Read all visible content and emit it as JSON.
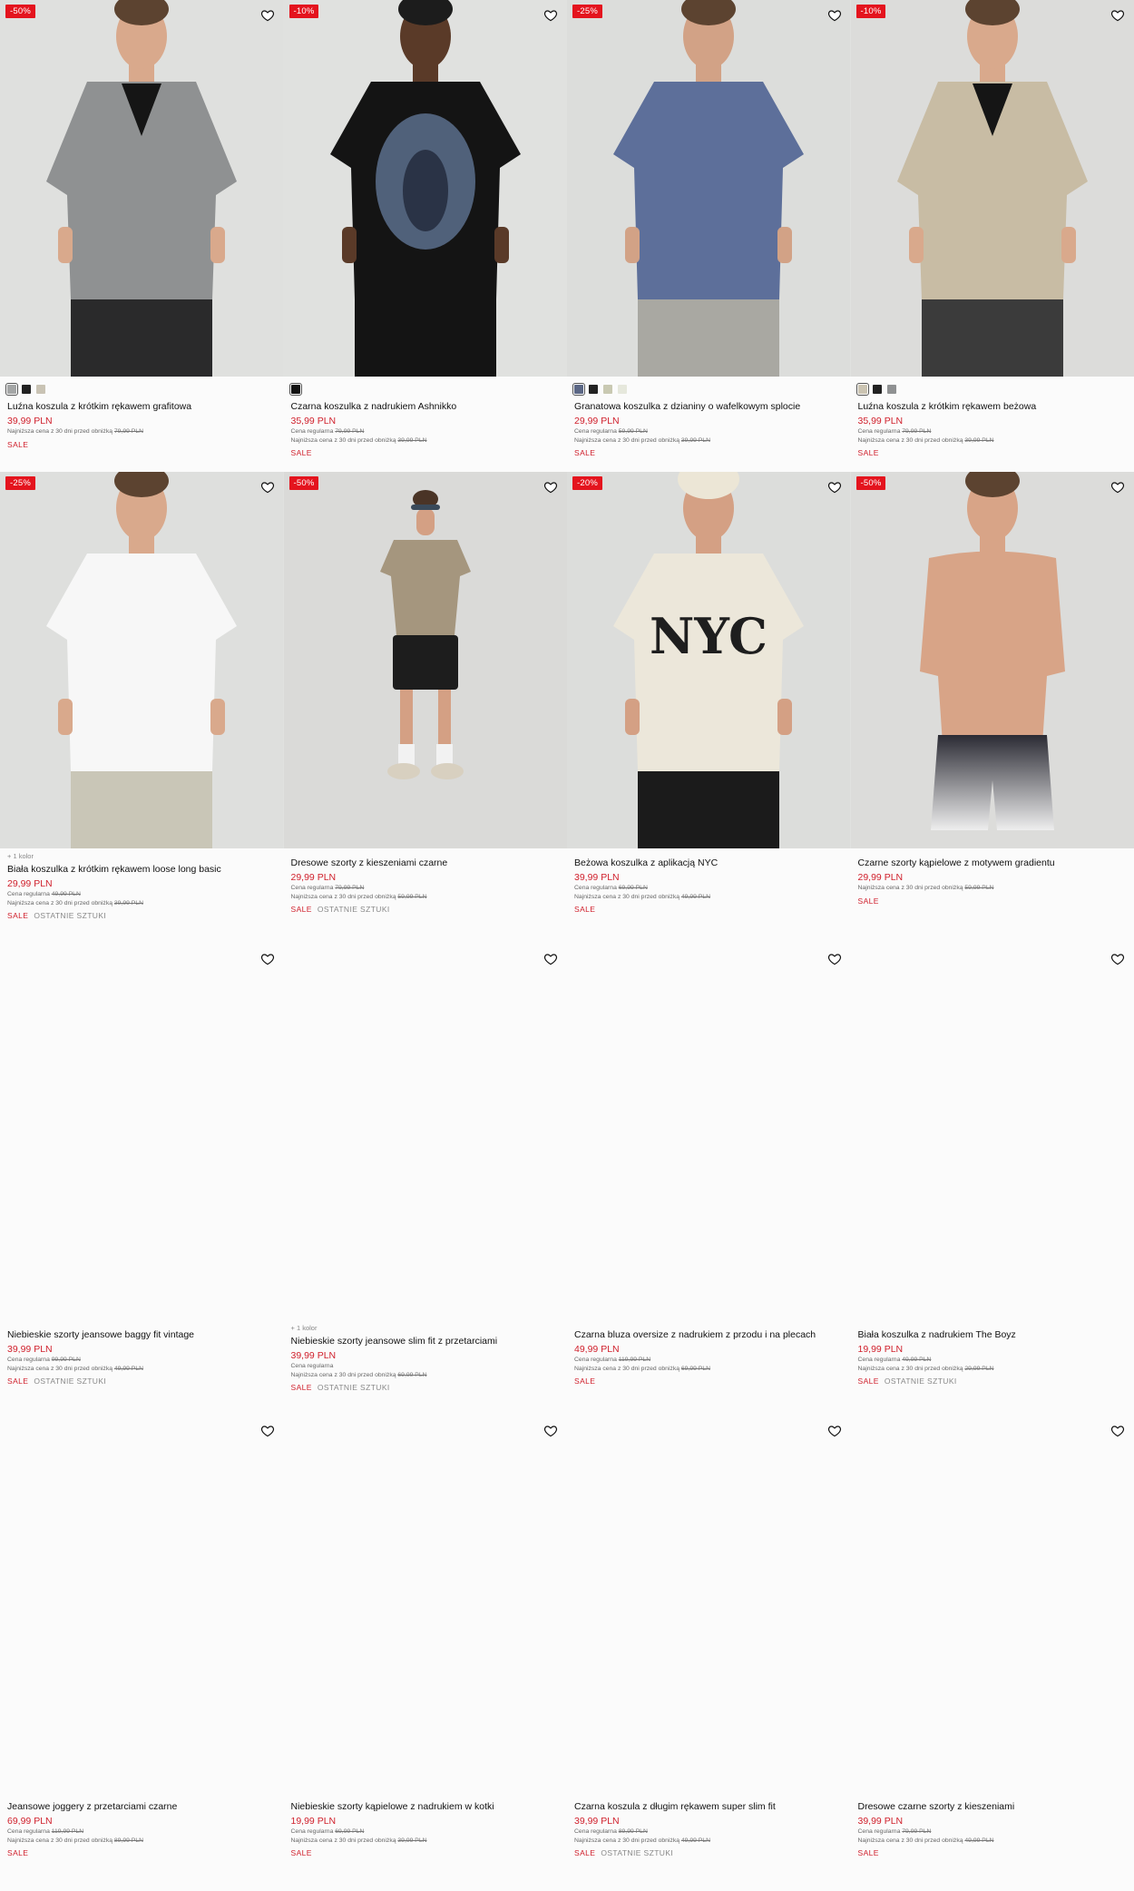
{
  "products": [
    {
      "name": "Luźna koszula z krótkim rękawem grafitowa",
      "price": "39,99 PLN",
      "discount": "-50%",
      "regular_label": "",
      "regular_price": "",
      "lowest_label": "Najniższa cena z 30 dni przed obniżką",
      "lowest_price": "79,99 PLN",
      "tags": [
        "SALE"
      ],
      "swatches": [
        "#a4a6a6",
        "#222222",
        "#c9c3b4"
      ],
      "more_colors": "",
      "image": {
        "bg": "#dfe0de",
        "top": "#8f9192",
        "bottom": "#2a2a2b",
        "skin": "#d9a98c",
        "shape": "shirt"
      }
    },
    {
      "name": "Czarna koszulka z nadrukiem Ashnikko",
      "price": "35,99 PLN",
      "discount": "-10%",
      "regular_label": "Cena regularna",
      "regular_price": "79,99 PLN",
      "lowest_label": "Najniższa cena z 30 dni przed obniżką",
      "lowest_price": "39,99 PLN",
      "tags": [
        "SALE"
      ],
      "swatches": [
        "#111111"
      ],
      "more_colors": "",
      "image": {
        "bg": "#e0e1df",
        "top": "#141414",
        "bottom": "#141414",
        "skin": "#5a3a28",
        "shape": "tee-print"
      }
    },
    {
      "name": "Granatowa koszulka z dzianiny o wafelkowym splocie",
      "price": "29,99 PLN",
      "discount": "-25%",
      "regular_label": "Cena regularna",
      "regular_price": "59,99 PLN",
      "lowest_label": "Najniższa cena z 30 dni przed obniżką",
      "lowest_price": "39,99 PLN",
      "tags": [
        "SALE"
      ],
      "swatches": [
        "#5b6785",
        "#222222",
        "#c9c9b2",
        "#e6e8dc"
      ],
      "more_colors": "",
      "image": {
        "bg": "#dcdddb",
        "top": "#5d6f9a",
        "bottom": "#a9a8a2",
        "skin": "#d2a286",
        "shape": "tee"
      }
    },
    {
      "name": "Luźna koszula z krótkim rękawem beżowa",
      "price": "35,99 PLN",
      "discount": "-10%",
      "regular_label": "Cena regularna",
      "regular_price": "79,99 PLN",
      "lowest_label": "Najniższa cena z 30 dni przed obniżką",
      "lowest_price": "39,99 PLN",
      "tags": [
        "SALE"
      ],
      "swatches": [
        "#cbc4b2",
        "#222222",
        "#8f9192"
      ],
      "more_colors": "",
      "image": {
        "bg": "#dcdcda",
        "top": "#c8bca4",
        "bottom": "#3b3b3b",
        "skin": "#d9a98c",
        "shape": "shirt"
      }
    },
    {
      "name": "Biała koszulka z krótkim rękawem loose long basic",
      "price": "29,99 PLN",
      "discount": "-25%",
      "regular_label": "Cena regularna",
      "regular_price": "49,99 PLN",
      "lowest_label": "Najniższa cena z 30 dni przed obniżką",
      "lowest_price": "39,99 PLN",
      "tags": [
        "SALE",
        "OSTATNIE SZTUKI"
      ],
      "swatches": [],
      "more_colors": "+ 1 kolor",
      "image": {
        "bg": "#dedfdd",
        "top": "#f7f7f7",
        "bottom": "#c9c6b7",
        "skin": "#d9a98c",
        "shape": "tee"
      }
    },
    {
      "name": "Dresowe szorty z kieszeniami czarne",
      "price": "29,99 PLN",
      "discount": "-50%",
      "regular_label": "Cena regularna",
      "regular_price": "79,99 PLN",
      "lowest_label": "Najniższa cena z 30 dni przed obniżką",
      "lowest_price": "59,99 PLN",
      "tags": [
        "SALE",
        "OSTATNIE SZTUKI"
      ],
      "swatches": [],
      "more_colors": "",
      "image": {
        "bg": "#dadad8",
        "top": "#a5967e",
        "bottom": "#1d1d1d",
        "skin": "#d4a084",
        "shape": "full"
      }
    },
    {
      "name": "Beżowa koszulka z aplikacją NYC",
      "price": "39,99 PLN",
      "discount": "-20%",
      "regular_label": "Cena regularna",
      "regular_price": "69,99 PLN",
      "lowest_label": "Najniższa cena z 30 dni przed obniżką",
      "lowest_price": "49,99 PLN",
      "tags": [
        "SALE"
      ],
      "swatches": [],
      "more_colors": "",
      "image": {
        "bg": "#dcdddb",
        "top": "#ece7da",
        "bottom": "#1b1b1b",
        "skin": "#d4a084",
        "shape": "tee-nyc"
      }
    },
    {
      "name": "Czarne szorty kąpielowe z motywem gradientu",
      "price": "29,99 PLN",
      "discount": "-50%",
      "regular_label": "",
      "regular_price": "",
      "lowest_label": "Najniższa cena z 30 dni przed obniżką",
      "lowest_price": "59,99 PLN",
      "tags": [
        "SALE"
      ],
      "swatches": [],
      "more_colors": "",
      "image": {
        "bg": "#dcdcda",
        "top": "#d8a487",
        "bottom": "#2b2b34",
        "skin": "#d8a487",
        "shape": "shirtless"
      }
    },
    {
      "name": "Niebieskie szorty jeansowe baggy fit vintage",
      "price": "39,99 PLN",
      "discount": "",
      "regular_label": "Cena regularna",
      "regular_price": "99,99 PLN",
      "lowest_label": "Najniższa cena z 30 dni przed obniżką",
      "lowest_price": "49,99 PLN",
      "tags": [
        "SALE",
        "OSTATNIE SZTUKI"
      ],
      "swatches": [],
      "more_colors": "",
      "image": null
    },
    {
      "name": "Niebieskie szorty jeansowe slim fit z przetarciami",
      "price": "39,99 PLN",
      "discount": "",
      "regular_label": "Cena regularna",
      "regular_price": "",
      "lowest_label": "Najniższa cena z 30 dni przed obniżką",
      "lowest_price": "69,99 PLN",
      "tags": [
        "SALE",
        "OSTATNIE SZTUKI"
      ],
      "swatches": [],
      "more_colors": "+ 1 kolor",
      "image": null
    },
    {
      "name": "Czarna bluza oversize z nadrukiem z przodu i na plecach",
      "price": "49,99 PLN",
      "discount": "",
      "regular_label": "Cena regularna",
      "regular_price": "119,99 PLN",
      "lowest_label": "Najniższa cena z 30 dni przed obniżką",
      "lowest_price": "69,99 PLN",
      "tags": [
        "SALE"
      ],
      "swatches": [],
      "more_colors": "",
      "image": null
    },
    {
      "name": "Biała koszulka z nadrukiem The Boyz",
      "price": "19,99 PLN",
      "discount": "",
      "regular_label": "Cena regularna",
      "regular_price": "49,99 PLN",
      "lowest_label": "Najniższa cena z 30 dni przed obniżką",
      "lowest_price": "29,99 PLN",
      "tags": [
        "SALE",
        "OSTATNIE SZTUKI"
      ],
      "swatches": [],
      "more_colors": "",
      "image": null
    },
    {
      "name": "Jeansowe joggery z przetarciami czarne",
      "price": "69,99 PLN",
      "discount": "",
      "regular_label": "Cena regularna",
      "regular_price": "119,99 PLN",
      "lowest_label": "Najniższa cena z 30 dni przed obniżką",
      "lowest_price": "89,99 PLN",
      "tags": [
        "SALE"
      ],
      "swatches": [],
      "more_colors": "",
      "image": null
    },
    {
      "name": "Niebieskie szorty kąpielowe z nadrukiem w kotki",
      "price": "19,99 PLN",
      "discount": "",
      "regular_label": "Cena regularna",
      "regular_price": "69,99 PLN",
      "lowest_label": "Najniższa cena z 30 dni przed obniżką",
      "lowest_price": "39,99 PLN",
      "tags": [
        "SALE"
      ],
      "swatches": [],
      "more_colors": "",
      "image": null
    },
    {
      "name": "Czarna koszula z długim rękawem super slim fit",
      "price": "39,99 PLN",
      "discount": "",
      "regular_label": "Cena regularna",
      "regular_price": "89,99 PLN",
      "lowest_label": "Najniższa cena z 30 dni przed obniżką",
      "lowest_price": "49,99 PLN",
      "tags": [
        "SALE",
        "OSTATNIE SZTUKI"
      ],
      "swatches": [],
      "more_colors": "",
      "image": null
    },
    {
      "name": "Dresowe czarne szorty z kieszeniami",
      "price": "39,99 PLN",
      "discount": "",
      "regular_label": "Cena regularna",
      "regular_price": "79,99 PLN",
      "lowest_label": "Najniższa cena z 30 dni przed obniżką",
      "lowest_price": "49,99 PLN",
      "tags": [
        "SALE"
      ],
      "swatches": [],
      "more_colors": "",
      "image": null
    }
  ],
  "image_text": {
    "nyc": "NYC"
  },
  "icons": {
    "wishlist": "heart-icon"
  },
  "colors": {
    "sale_red": "#d0202c",
    "badge_red": "#e4141e"
  }
}
